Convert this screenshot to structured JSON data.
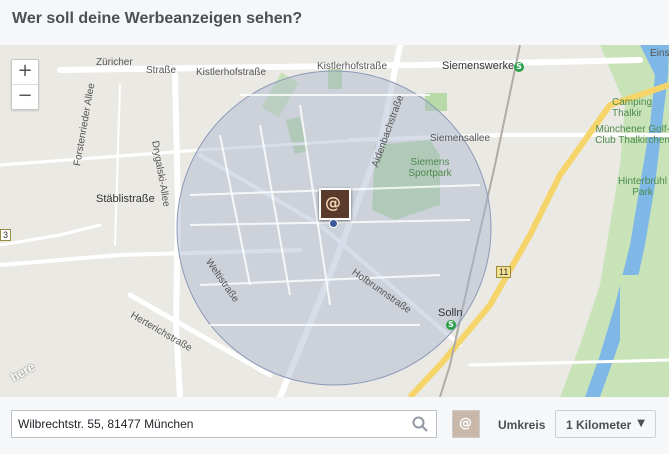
{
  "header": {
    "title": "Wer soll deine Werbeanzeigen sehen?"
  },
  "map": {
    "zoom_in": "+",
    "zoom_out": "−",
    "streets": {
      "zuricher": "Züricher",
      "strasse": "Straße",
      "kistlerhofstrasse_a": "Kistlerhofstraße",
      "kistlerhofstrasse_b": "Kistlerhofstraße",
      "forstenrieder": "Forstenrieder Allee",
      "drygalski": "Drygalski-Allee",
      "stablistrasse": "Stäblistraße",
      "aidenbachstrasse": "Aidenbachstraße",
      "siemensallee": "Siemensallee",
      "weltistrasse": "Weltistraße",
      "hofbrunnstrasse": "Hofbrunnstraße",
      "herterichstrasse": "Herterichstraße"
    },
    "places": {
      "siemenswerke": "Siemenswerke",
      "solln": "Solln",
      "siemens_sportpark": "Siemens Sportpark",
      "camping_thalkirchen": "Camping Thalkir",
      "golf_club": "Münchener Golf-Club Thalkirchen",
      "hinterbruhl_park": "Hinterbrühl Park",
      "einst": "Einst"
    },
    "sbahn_symbol": "S",
    "road_number": "11",
    "left_road_number": "3",
    "provider": "here",
    "pin_icon": "page-profile-icon",
    "radius_color": "#a9b6cf",
    "park_color": "#b8d9a8",
    "water_color": "#7fb8e6"
  },
  "location": {
    "address_value": "Wilbrechtstr. 55, 81477 München",
    "thumbnail_icon": "page-profile-icon"
  },
  "radius": {
    "label": "Umkreis",
    "selected": "1 Kilometer",
    "caret": "▼"
  }
}
